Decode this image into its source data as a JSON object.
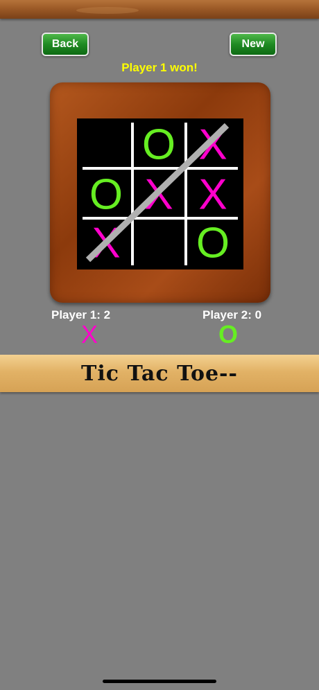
{
  "buttons": {
    "back_label": "Back",
    "new_label": "New"
  },
  "status_text": "Player 1 won!",
  "board": {
    "cells": [
      "",
      "O",
      "X",
      "O",
      "X",
      "X",
      "X",
      "",
      "O"
    ],
    "win_line": "diagonal from bottom-left to top-right",
    "colors": {
      "x": "#ff00cc",
      "o": "#66ee22",
      "grid": "#ffffff",
      "strike": "#b0b0b0"
    }
  },
  "scores": {
    "player1_label": "Player 1: 2",
    "player1_symbol": "X",
    "player2_label": "Player 2: 0",
    "player2_symbol": "O"
  },
  "title": "Tic Tac Toe--"
}
